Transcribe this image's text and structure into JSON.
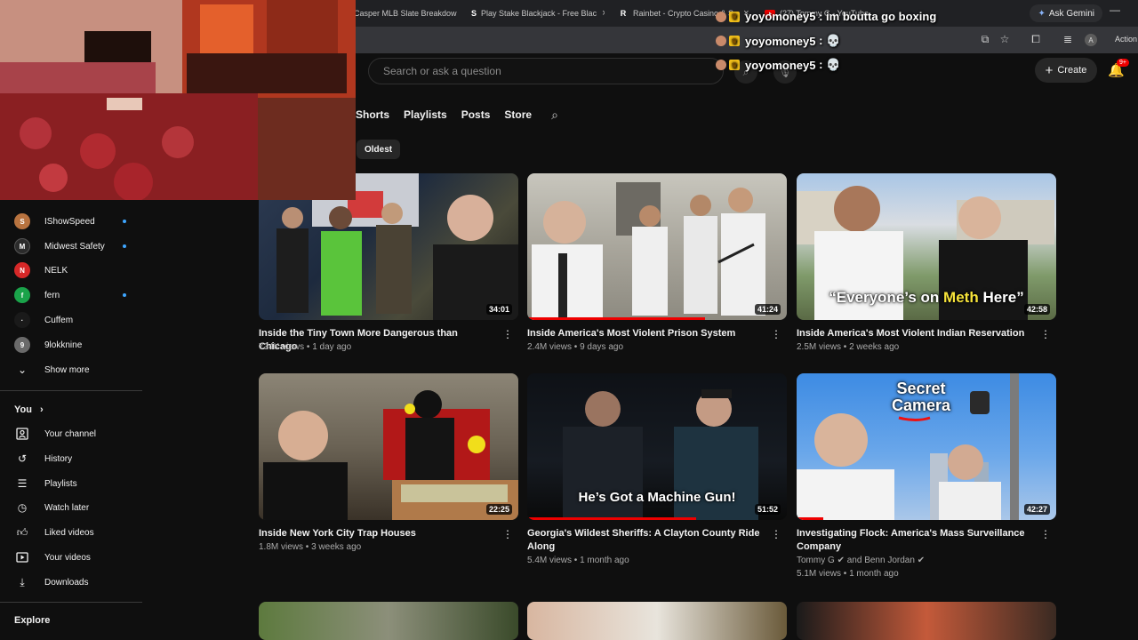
{
  "browser": {
    "tabs": [
      {
        "title": "Casper MLB Slate Breakdow",
        "favicon": ""
      },
      {
        "title": "Play Stake Blackjack - Free Blac",
        "favicon": "S"
      },
      {
        "title": "Rainbet - Crypto Casino & Sp",
        "favicon": "R"
      },
      {
        "title": "(27) Tommy G - YouTube",
        "favicon": ""
      }
    ],
    "ask_gemini": "Ask Gemini",
    "action_label": "Action r",
    "avatar_letter": "A"
  },
  "youtube": {
    "search_placeholder": "Search or ask a question",
    "create_label": "Create",
    "notif_badge": "9+",
    "channel_tabs": [
      "Shorts",
      "Playlists",
      "Posts",
      "Store"
    ],
    "sort_chip": "Oldest"
  },
  "sidebar": {
    "subscriptions": [
      {
        "name": "IShowSpeed",
        "color": "#b8733f",
        "live": true
      },
      {
        "name": "Midwest Safety",
        "color": "#2b2b2b",
        "live": true
      },
      {
        "name": "NELK",
        "color": "#d62828",
        "live": false
      },
      {
        "name": "fern",
        "color": "#1aa34a",
        "live": true
      },
      {
        "name": "Cuffem",
        "color": "#1a1a1a",
        "live": false
      },
      {
        "name": "9lokknine",
        "color": "#6a6a6a",
        "live": false
      }
    ],
    "show_more": "Show more",
    "you_heading": "You",
    "you_items": [
      "Your channel",
      "History",
      "Playlists",
      "Watch later",
      "Liked videos",
      "Your videos",
      "Downloads"
    ],
    "explore_heading": "Explore"
  },
  "videos": [
    {
      "title": "Inside the Tiny Town More Dangerous than Chicago",
      "title2": "",
      "views": "734K views",
      "age": "1 day ago",
      "duration": "34:01",
      "overlay": ""
    },
    {
      "title": "Inside America's Most Violent Prison System",
      "title2": "",
      "views": "2.4M views",
      "age": "9 days ago",
      "duration": "41:24",
      "overlay": ""
    },
    {
      "title": "Inside America's Most Violent Indian Reservation",
      "title2": "",
      "views": "2.5M views",
      "age": "2 weeks ago",
      "duration": "42:58",
      "overlay_pre": "“Everyone’s on ",
      "overlay_hi": "Meth",
      "overlay_post": " Here”"
    },
    {
      "title": "Inside New York City Trap Houses",
      "title2": "",
      "views": "1.8M views",
      "age": "3 weeks ago",
      "duration": "22:25",
      "overlay": ""
    },
    {
      "title": "Georgia's Wildest Sheriffs: A Clayton County Ride",
      "title2": "Along",
      "views": "5.4M views",
      "age": "1 month ago",
      "duration": "51:52",
      "overlay": "He’s Got a Machine Gun!"
    },
    {
      "title": "Investigating Flock: America's Mass Surveillance",
      "title2": "Company",
      "byline1": "Tommy G",
      "byline_and": "and Benn Jordan",
      "views": "5.1M views",
      "age": "1 month ago",
      "duration": "42:27",
      "overlay_line1": "Secret",
      "overlay_line2": "Camera"
    }
  ],
  "chat": [
    {
      "user": "yoyomoney5",
      "message": ": im boutta go boxing"
    },
    {
      "user": "yoyomoney5",
      "message": ": 💀"
    },
    {
      "user": "yoyomoney5",
      "message": ": 💀"
    }
  ]
}
